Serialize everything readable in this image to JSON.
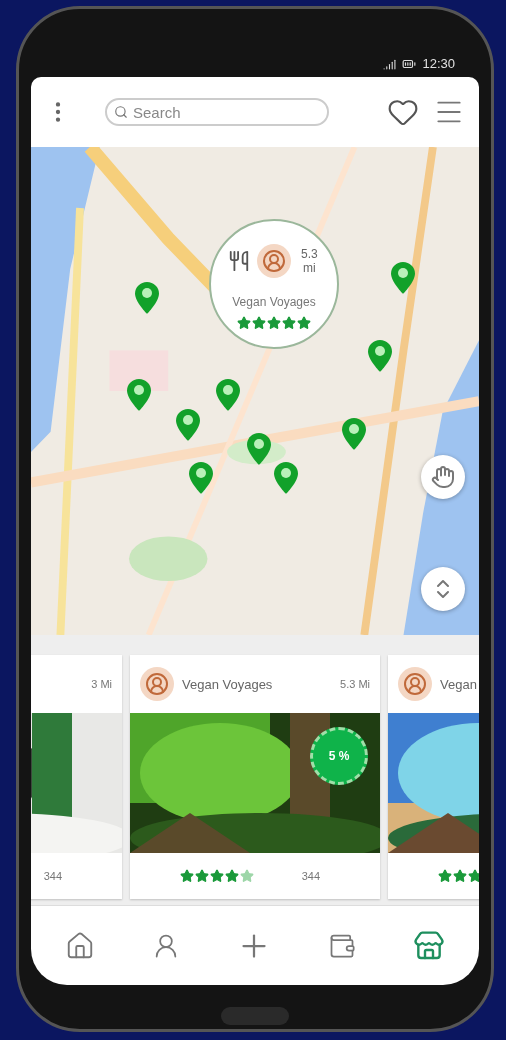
{
  "status_bar": {
    "time": "12:30"
  },
  "header": {
    "search": {
      "placeholder": "Search"
    }
  },
  "map": {
    "kind": "picture",
    "popup": {
      "distance": "5.3 mi",
      "name": "Vegan Voyages",
      "stars": 5
    }
  },
  "cards": [
    {
      "distance": "3 Mi",
      "count": "344"
    },
    {
      "name": "Vegan Voyages",
      "distance": "5.3 Mi",
      "badge": "5 %",
      "stars": 4,
      "count": "344"
    },
    {
      "name": "Vegan",
      "stars": 3,
      "cut_off": true
    }
  ],
  "nav": [
    {
      "kind": "home",
      "selected": false
    },
    {
      "kind": "person",
      "selected": false
    },
    {
      "kind": "add",
      "selected": false
    },
    {
      "kind": "wallet",
      "selected": false
    },
    {
      "kind": "store",
      "selected": true
    }
  ]
}
